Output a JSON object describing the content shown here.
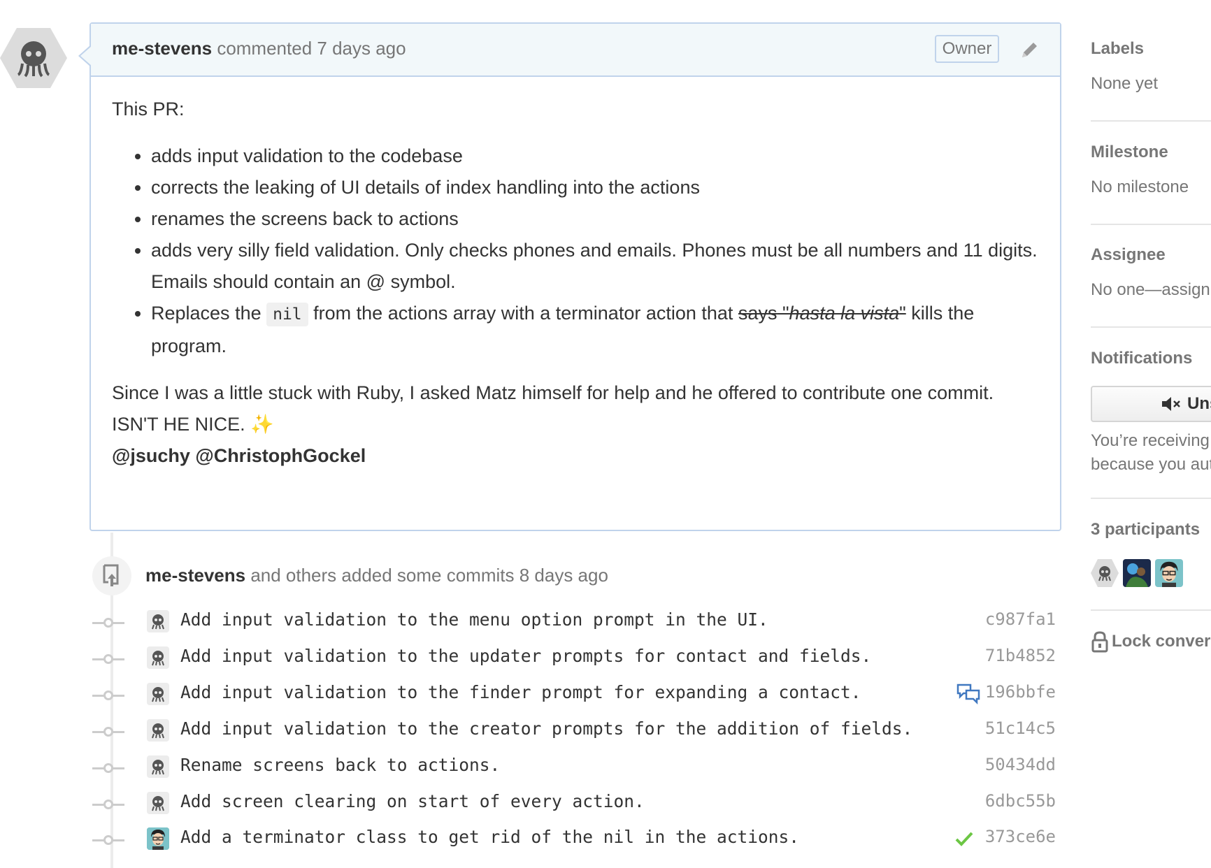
{
  "comment": {
    "author": "me-stevens",
    "action": "commented",
    "time": "7 days ago",
    "badge": "Owner",
    "intro": "This PR:",
    "bullets": [
      "adds input validation to the codebase",
      "corrects the leaking of UI details of index handling into the actions",
      "renames the screens back to actions",
      "adds very silly field validation. Only checks phones and emails. Phones must be all numbers and 11 digits. Emails should contain an @ symbol."
    ],
    "bullet5": {
      "pre": "Replaces the ",
      "code": "nil",
      "mid": " from the actions array with a terminator action that ",
      "strike_says": "says",
      "strike_quote_open": " \"",
      "strike_italic": "hasta la vista",
      "strike_quote_close": "\"",
      "post": " kills the program."
    },
    "paragraph": "Since I was a little stuck with Ruby, I asked Matz himself for help and he offered to contribute one commit. ISN'T HE NICE.",
    "sparkle": "✨",
    "mentions": "@jsuchy @ChristophGockel"
  },
  "commits": {
    "author": "me-stevens",
    "summary": "and others added some commits 8 days ago",
    "items": [
      {
        "message": "Add input validation to the menu option prompt in the UI.",
        "sha": "c987fa1",
        "status": ""
      },
      {
        "message": "Add input validation to the updater prompts for contact and fields.",
        "sha": "71b4852",
        "status": ""
      },
      {
        "message": "Add input validation to the finder prompt for expanding a contact.",
        "sha": "196bbfe",
        "status": "comment"
      },
      {
        "message": "Add input validation to the creator prompts for the addition of fields.",
        "sha": "51c14c5",
        "status": ""
      },
      {
        "message": "Rename screens back to actions.",
        "sha": "50434dd",
        "status": ""
      },
      {
        "message": "Add screen clearing on start of every action.",
        "sha": "6dbc55b",
        "status": ""
      },
      {
        "message": "Add a terminator class to get rid of the nil in the actions.",
        "sha": "373ce6e",
        "status": "success"
      }
    ]
  },
  "sidebar": {
    "labels": {
      "heading": "Labels",
      "value": "None yet"
    },
    "milestone": {
      "heading": "Milestone",
      "value": "No milestone"
    },
    "assignee": {
      "heading": "Assignee",
      "value": "No one—assign yourself"
    },
    "notifications": {
      "heading": "Notifications",
      "button": "Unsubscribe",
      "line1": "You’re receiving notifications",
      "line2": "because you authored the thread."
    },
    "participants": {
      "heading": "3 participants"
    },
    "lock": "Lock conversation"
  },
  "colors": {
    "accent_border": "#c0d3eb",
    "header_bg": "#f2f8fa",
    "success": "#6cc644",
    "comment_icon": "#4078c0"
  }
}
